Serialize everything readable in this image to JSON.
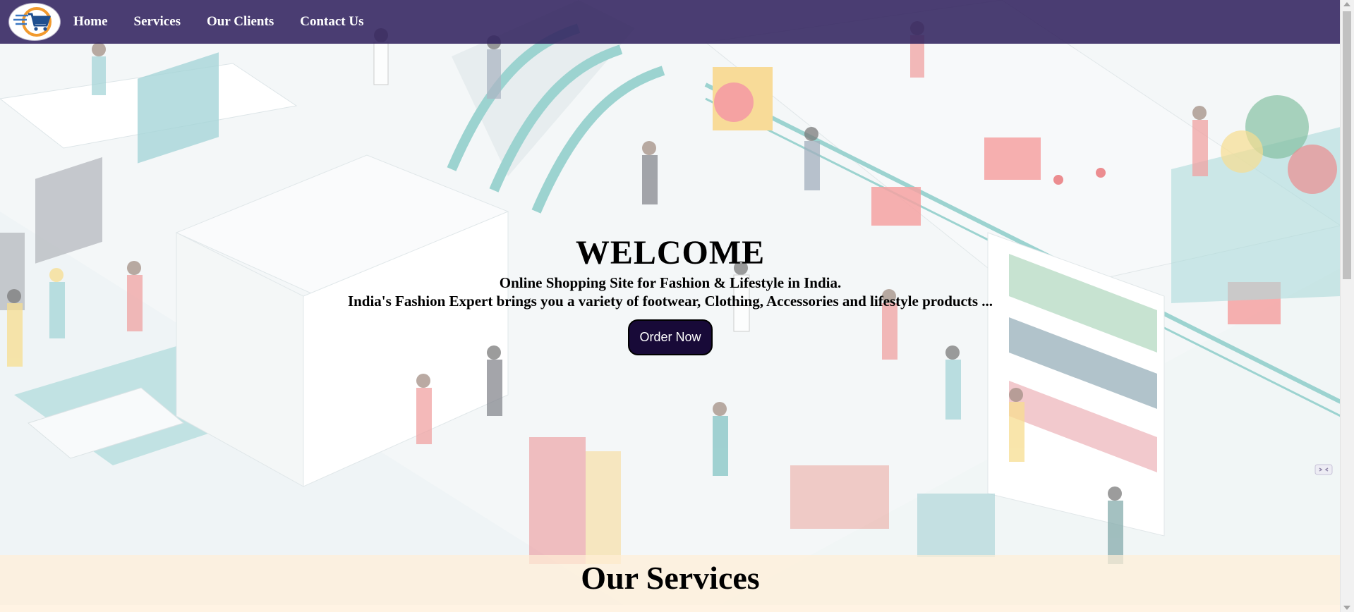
{
  "nav": {
    "logo_icon": "shopping-cart-logo-icon",
    "links": [
      "Home",
      "Services",
      "Our Clients",
      "Contact Us"
    ]
  },
  "hero": {
    "title": "WELCOME",
    "line1": "Online Shopping Site for Fashion & Lifestyle in India.",
    "line2": "India's Fashion Expert brings you a variety of footwear, Clothing, Accessories and lifestyle products ...",
    "cta_label": "Order Now"
  },
  "services": {
    "heading": "Our Services"
  },
  "colors": {
    "navbar": "#32235f",
    "cta_background": "#180a38",
    "services_band": "#ffeed7",
    "accent_teal": "#5fb8b4"
  }
}
